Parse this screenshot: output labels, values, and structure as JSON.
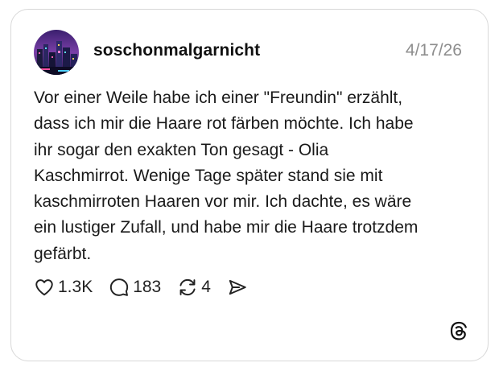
{
  "post": {
    "username": "soschonmalgarnicht",
    "date": "4/17/26",
    "text": "Vor einer Weile habe ich einer \"Freundin\" erzählt,\ndass ich mir die Haare rot färben möchte. Ich habe\nihr sogar den exakten Ton gesagt - Olia\nKaschmirrot. Wenige Tage später stand sie mit\nkaschmirroten Haaren vor mir. Ich dachte, es wäre\nein lustiger Zufall, und habe mir die Haare trotzdem\ngefärbt.",
    "avatar_icon": "avatar-cityscape-image"
  },
  "actions": {
    "like": {
      "icon": "heart-icon",
      "count": "1.3K"
    },
    "reply": {
      "icon": "comment-bubble-icon",
      "count": "183"
    },
    "repost": {
      "icon": "repost-icon",
      "count": "4"
    },
    "share": {
      "icon": "send-icon"
    }
  },
  "branding": {
    "logo": "threads-logo-icon"
  },
  "colors": {
    "border": "#d8d8d8",
    "date_text": "#8e8e8e",
    "text": "#1a1a1a"
  }
}
